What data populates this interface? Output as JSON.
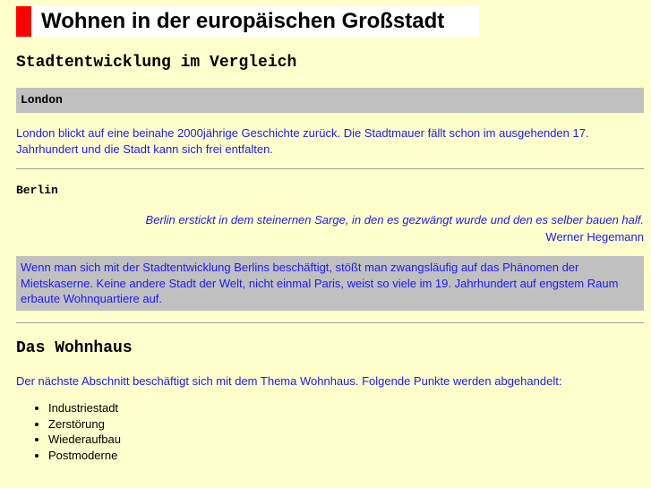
{
  "title": "Wohnen in der europäischen Großstadt",
  "subtitle": "Stadtentwicklung im Vergleich",
  "london": {
    "heading": "London",
    "text": "London blickt auf eine beinahe 2000jährige Geschichte zurück. Die Stadtmauer fällt schon im ausgehenden 17. Jahrhundert und die Stadt kann sich frei entfalten."
  },
  "berlin": {
    "heading": "Berlin",
    "quote": "Berlin erstickt in dem steinernen Sarge, in den es gezwängt wurde und den es selber bauen half.",
    "quote_author": "Werner Hegemann",
    "text": "Wenn man sich mit der Stadtentwicklung Berlins beschäftigt, stößt man zwangsläufig auf das Phänomen der Mietskaserne. Keine andere Stadt der Welt, nicht einmal Paris, weist so viele im 19. Jahrhundert auf engstem Raum erbaute Wohnquartiere auf."
  },
  "wohnhaus": {
    "heading": "Das Wohnhaus",
    "text": "Der nächste Abschnitt beschäftigt sich mit dem Thema Wohnhaus. Folgende Punkte werden abgehandelt:",
    "items": [
      "Industriestadt",
      "Zerstörung",
      "Wiederaufbau",
      "Postmoderne"
    ]
  }
}
